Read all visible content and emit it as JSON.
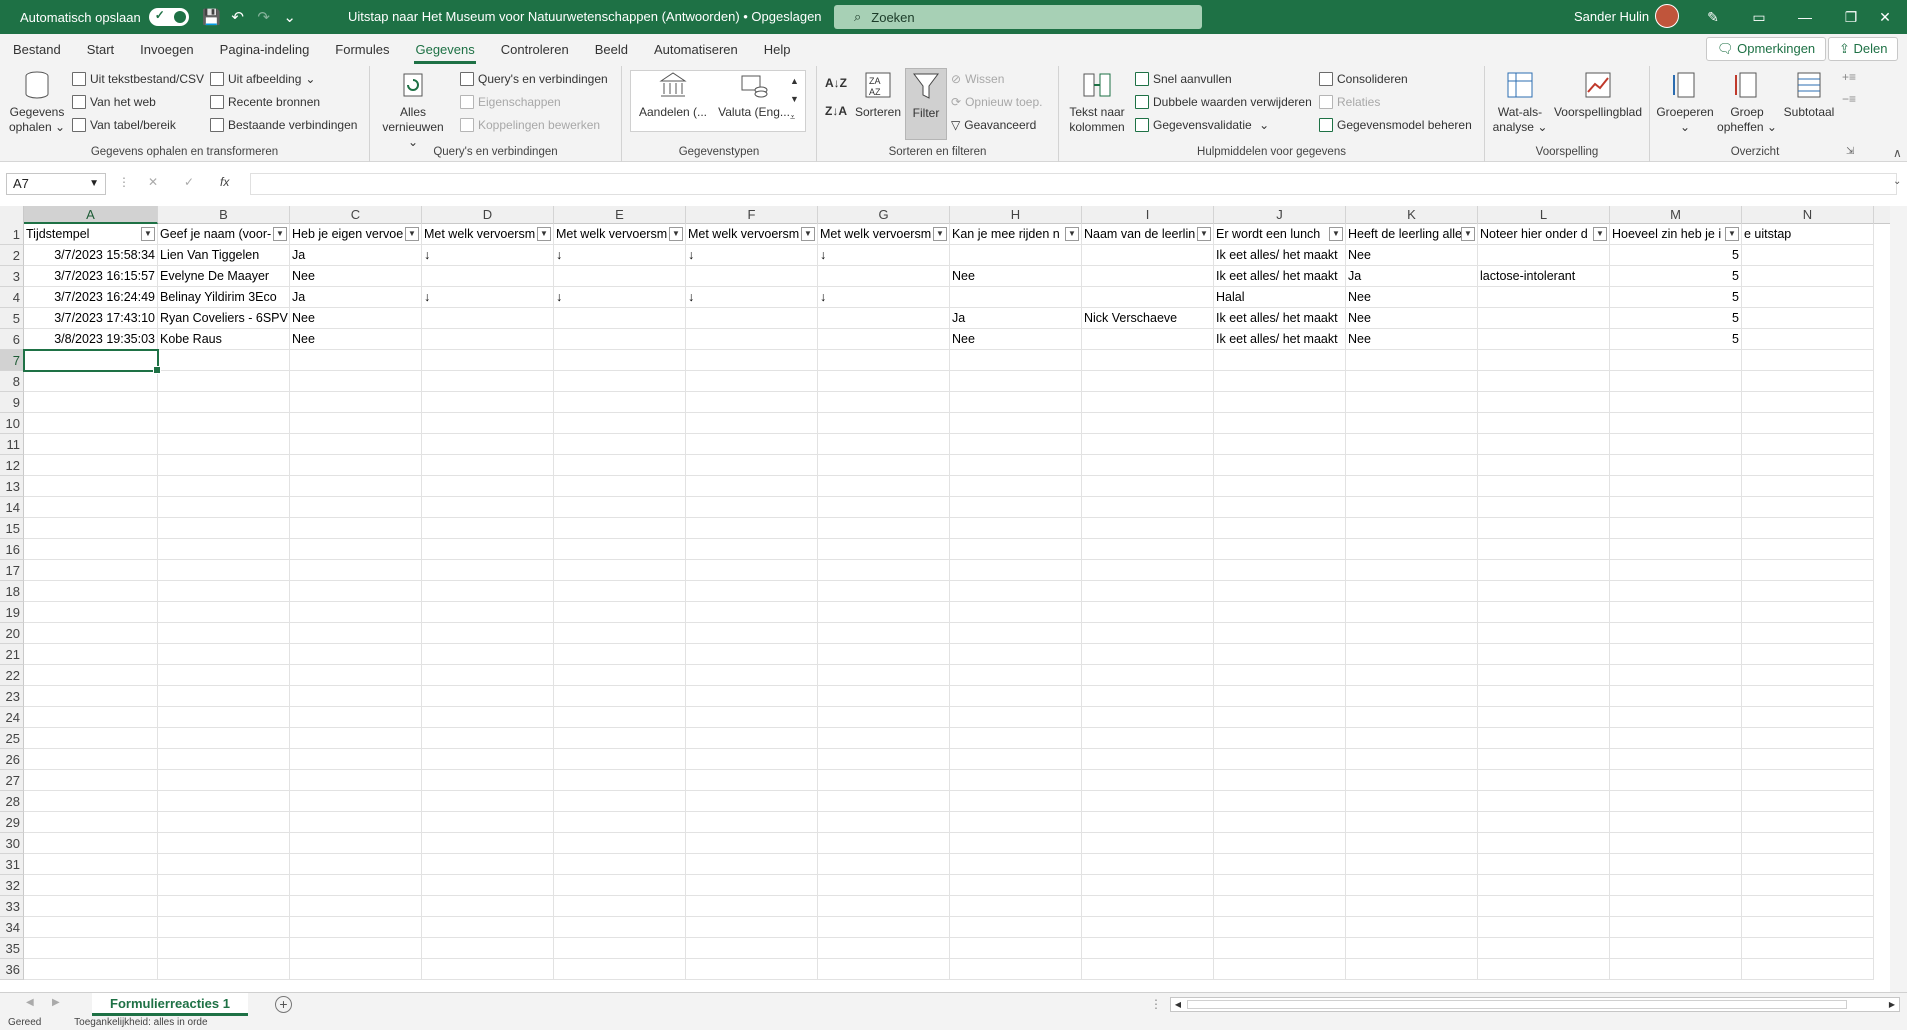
{
  "titlebar": {
    "autosave_label": "Automatisch opslaan",
    "doc_title": "Uitstap naar Het Museum voor Natuurwetenschappen  (Antwoorden)  •  Opgeslagen",
    "search_placeholder": "Zoeken",
    "user_name": "Sander Hulin"
  },
  "menu": {
    "tabs": [
      "Bestand",
      "Start",
      "Invoegen",
      "Pagina-indeling",
      "Formules",
      "Gegevens",
      "Controleren",
      "Beeld",
      "Automatiseren",
      "Help"
    ],
    "active": "Gegevens",
    "comments_label": "Opmerkingen",
    "share_label": "Delen"
  },
  "ribbon": {
    "groups": {
      "get_transform": {
        "label": "Gegevens ophalen en transformeren",
        "get_data": "Gegevens ophalen",
        "from_text": "Uit tekstbestand/CSV",
        "from_web": "Van het web",
        "from_table": "Van tabel/bereik",
        "from_picture": "Uit afbeelding",
        "recent_sources": "Recente bronnen",
        "existing_connections": "Bestaande verbindingen"
      },
      "queries": {
        "label": "Query's en verbindingen",
        "refresh_all": "Alles vernieuwen",
        "queries_connections": "Query's en verbindingen",
        "properties": "Eigenschappen",
        "edit_links": "Koppelingen bewerken"
      },
      "datatypes": {
        "label": "Gegevenstypen",
        "stocks": "Aandelen (...",
        "currencies": "Valuta (Eng..."
      },
      "sort_filter": {
        "label": "Sorteren en filteren",
        "sort": "Sorteren",
        "filter": "Filter",
        "clear": "Wissen",
        "reapply": "Opnieuw toep.",
        "advanced": "Geavanceerd"
      },
      "data_tools": {
        "label": "Hulpmiddelen voor gegevens",
        "text_to_columns": "Tekst naar kolommen",
        "flash_fill": "Snel aanvullen",
        "remove_duplicates": "Dubbele waarden verwijderen",
        "data_validation": "Gegevensvalidatie",
        "consolidate": "Consolideren",
        "relations": "Relaties",
        "data_model": "Gegevensmodel beheren"
      },
      "forecast": {
        "label": "Voorspelling",
        "what_if": "Wat-als-analyse",
        "forecast_sheet": "Voorspellingblad"
      },
      "outline": {
        "label": "Overzicht",
        "group": "Groeperen",
        "ungroup": "Groep opheffen",
        "subtotal": "Subtotaal"
      }
    }
  },
  "formula_bar": {
    "name_box": "A7",
    "fx": "fx"
  },
  "grid": {
    "columns": [
      "A",
      "B",
      "C",
      "D",
      "E",
      "F",
      "G",
      "H",
      "I",
      "J",
      "K",
      "L",
      "M",
      "N"
    ],
    "rows": [
      "1",
      "2",
      "3",
      "4",
      "5",
      "6",
      "7",
      "8",
      "9",
      "10",
      "11",
      "12",
      "13",
      "14",
      "15",
      "16",
      "17",
      "18",
      "19",
      "20",
      "21",
      "22",
      "23",
      "24",
      "25",
      "26",
      "27",
      "28",
      "29",
      "30",
      "31",
      "32",
      "33",
      "34",
      "35",
      "36"
    ],
    "headers": [
      "Tijdstempel",
      "Geef je naam (voor-",
      "Heb je eigen vervoe",
      "Met welk vervoersm",
      "Met welk vervoersm",
      "Met welk vervoersm",
      "Met welk vervoersm",
      "Kan je mee rijden n",
      "Naam van de leerlin",
      "Er wordt een lunch",
      "Heeft de leerling alle",
      "Noteer hier onder d",
      "Hoeveel zin heb je i",
      "e uitstap"
    ],
    "data": [
      [
        "3/7/2023 15:58:34",
        "Lien Van Tiggelen",
        "Ja",
        "↓",
        "↓",
        "↓",
        "↓",
        "",
        "",
        "Ik eet alles/ het maakt",
        "Nee",
        "",
        "5",
        ""
      ],
      [
        "3/7/2023 16:15:57",
        "Evelyne De Maayer",
        "Nee",
        "",
        "",
        "",
        "",
        "Nee",
        "",
        "Ik eet alles/ het maakt",
        "Ja",
        "lactose-intolerant",
        "5",
        ""
      ],
      [
        "3/7/2023 16:24:49",
        "Belinay Yildirim 3Eco",
        "Ja",
        "↓",
        "↓",
        "↓",
        "↓",
        "",
        "",
        "Halal",
        "Nee",
        "",
        "5",
        ""
      ],
      [
        "3/7/2023 17:43:10",
        "Ryan Coveliers - 6SPV",
        "Nee",
        "",
        "",
        "",
        "",
        "Ja",
        "Nick Verschaeve",
        "Ik eet alles/ het maakt",
        "Nee",
        "",
        "5",
        ""
      ],
      [
        "3/8/2023 19:35:03",
        "Kobe Raus",
        "Nee",
        "",
        "",
        "",
        "",
        "Nee",
        "",
        "Ik eet alles/ het maakt",
        "Nee",
        "",
        "5",
        ""
      ]
    ],
    "active_cell": "A7"
  },
  "sheets": {
    "tabs": [
      "Formulierreacties 1"
    ],
    "add": "+"
  },
  "statusbar": {
    "ready": "Gereed",
    "accessibility": "Toegankelijkheid: alles in orde"
  },
  "colors": {
    "brand": "#1e7145",
    "search_bg": "#a7d0b5"
  }
}
